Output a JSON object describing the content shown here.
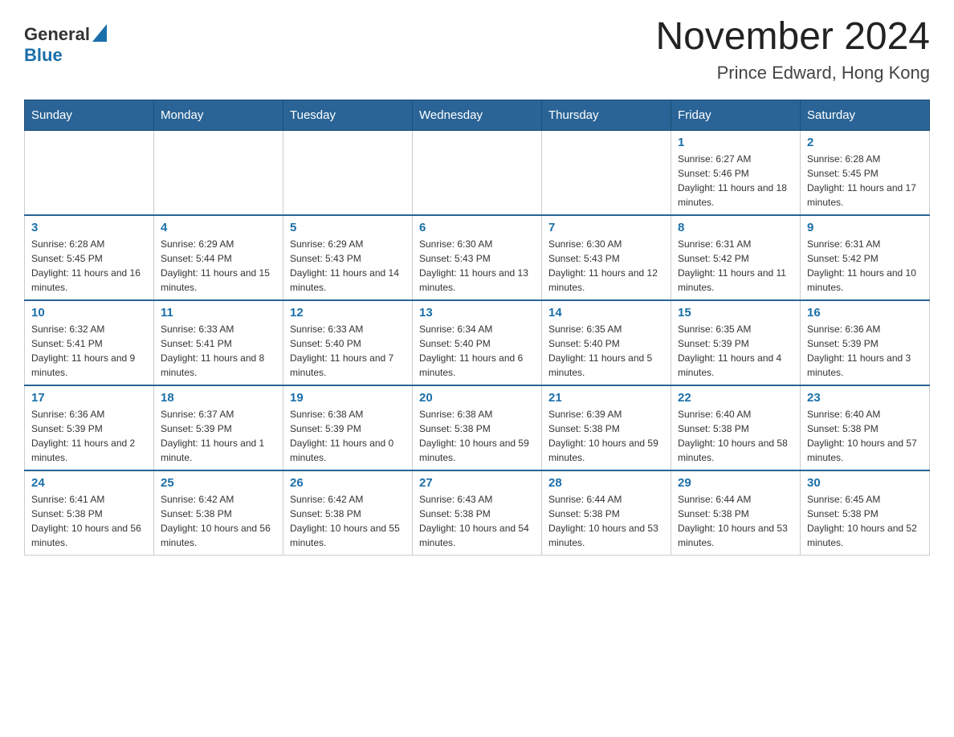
{
  "logo": {
    "general": "General",
    "blue": "Blue"
  },
  "title": "November 2024",
  "subtitle": "Prince Edward, Hong Kong",
  "weekdays": [
    "Sunday",
    "Monday",
    "Tuesday",
    "Wednesday",
    "Thursday",
    "Friday",
    "Saturday"
  ],
  "rows": [
    {
      "days": [
        {
          "number": "",
          "info": ""
        },
        {
          "number": "",
          "info": ""
        },
        {
          "number": "",
          "info": ""
        },
        {
          "number": "",
          "info": ""
        },
        {
          "number": "",
          "info": ""
        },
        {
          "number": "1",
          "info": "Sunrise: 6:27 AM\nSunset: 5:46 PM\nDaylight: 11 hours and 18 minutes."
        },
        {
          "number": "2",
          "info": "Sunrise: 6:28 AM\nSunset: 5:45 PM\nDaylight: 11 hours and 17 minutes."
        }
      ]
    },
    {
      "days": [
        {
          "number": "3",
          "info": "Sunrise: 6:28 AM\nSunset: 5:45 PM\nDaylight: 11 hours and 16 minutes."
        },
        {
          "number": "4",
          "info": "Sunrise: 6:29 AM\nSunset: 5:44 PM\nDaylight: 11 hours and 15 minutes."
        },
        {
          "number": "5",
          "info": "Sunrise: 6:29 AM\nSunset: 5:43 PM\nDaylight: 11 hours and 14 minutes."
        },
        {
          "number": "6",
          "info": "Sunrise: 6:30 AM\nSunset: 5:43 PM\nDaylight: 11 hours and 13 minutes."
        },
        {
          "number": "7",
          "info": "Sunrise: 6:30 AM\nSunset: 5:43 PM\nDaylight: 11 hours and 12 minutes."
        },
        {
          "number": "8",
          "info": "Sunrise: 6:31 AM\nSunset: 5:42 PM\nDaylight: 11 hours and 11 minutes."
        },
        {
          "number": "9",
          "info": "Sunrise: 6:31 AM\nSunset: 5:42 PM\nDaylight: 11 hours and 10 minutes."
        }
      ]
    },
    {
      "days": [
        {
          "number": "10",
          "info": "Sunrise: 6:32 AM\nSunset: 5:41 PM\nDaylight: 11 hours and 9 minutes."
        },
        {
          "number": "11",
          "info": "Sunrise: 6:33 AM\nSunset: 5:41 PM\nDaylight: 11 hours and 8 minutes."
        },
        {
          "number": "12",
          "info": "Sunrise: 6:33 AM\nSunset: 5:40 PM\nDaylight: 11 hours and 7 minutes."
        },
        {
          "number": "13",
          "info": "Sunrise: 6:34 AM\nSunset: 5:40 PM\nDaylight: 11 hours and 6 minutes."
        },
        {
          "number": "14",
          "info": "Sunrise: 6:35 AM\nSunset: 5:40 PM\nDaylight: 11 hours and 5 minutes."
        },
        {
          "number": "15",
          "info": "Sunrise: 6:35 AM\nSunset: 5:39 PM\nDaylight: 11 hours and 4 minutes."
        },
        {
          "number": "16",
          "info": "Sunrise: 6:36 AM\nSunset: 5:39 PM\nDaylight: 11 hours and 3 minutes."
        }
      ]
    },
    {
      "days": [
        {
          "number": "17",
          "info": "Sunrise: 6:36 AM\nSunset: 5:39 PM\nDaylight: 11 hours and 2 minutes."
        },
        {
          "number": "18",
          "info": "Sunrise: 6:37 AM\nSunset: 5:39 PM\nDaylight: 11 hours and 1 minute."
        },
        {
          "number": "19",
          "info": "Sunrise: 6:38 AM\nSunset: 5:39 PM\nDaylight: 11 hours and 0 minutes."
        },
        {
          "number": "20",
          "info": "Sunrise: 6:38 AM\nSunset: 5:38 PM\nDaylight: 10 hours and 59 minutes."
        },
        {
          "number": "21",
          "info": "Sunrise: 6:39 AM\nSunset: 5:38 PM\nDaylight: 10 hours and 59 minutes."
        },
        {
          "number": "22",
          "info": "Sunrise: 6:40 AM\nSunset: 5:38 PM\nDaylight: 10 hours and 58 minutes."
        },
        {
          "number": "23",
          "info": "Sunrise: 6:40 AM\nSunset: 5:38 PM\nDaylight: 10 hours and 57 minutes."
        }
      ]
    },
    {
      "days": [
        {
          "number": "24",
          "info": "Sunrise: 6:41 AM\nSunset: 5:38 PM\nDaylight: 10 hours and 56 minutes."
        },
        {
          "number": "25",
          "info": "Sunrise: 6:42 AM\nSunset: 5:38 PM\nDaylight: 10 hours and 56 minutes."
        },
        {
          "number": "26",
          "info": "Sunrise: 6:42 AM\nSunset: 5:38 PM\nDaylight: 10 hours and 55 minutes."
        },
        {
          "number": "27",
          "info": "Sunrise: 6:43 AM\nSunset: 5:38 PM\nDaylight: 10 hours and 54 minutes."
        },
        {
          "number": "28",
          "info": "Sunrise: 6:44 AM\nSunset: 5:38 PM\nDaylight: 10 hours and 53 minutes."
        },
        {
          "number": "29",
          "info": "Sunrise: 6:44 AM\nSunset: 5:38 PM\nDaylight: 10 hours and 53 minutes."
        },
        {
          "number": "30",
          "info": "Sunrise: 6:45 AM\nSunset: 5:38 PM\nDaylight: 10 hours and 52 minutes."
        }
      ]
    }
  ]
}
